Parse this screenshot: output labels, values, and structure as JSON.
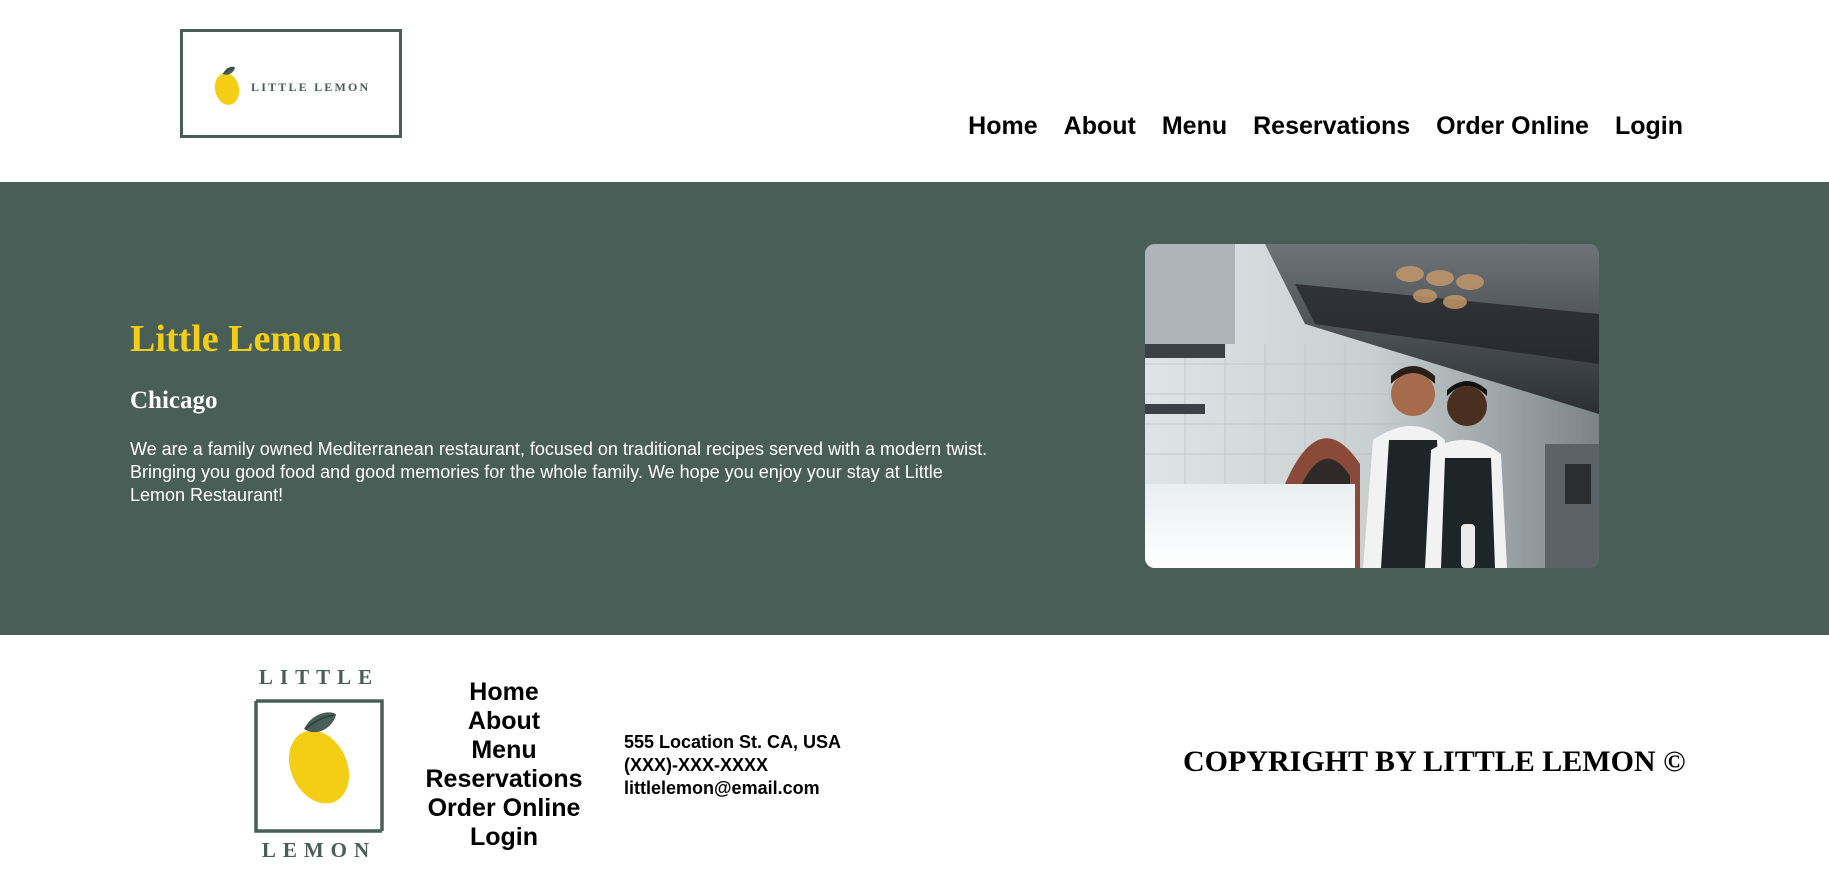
{
  "header": {
    "logo_text": "LITTLE LEMON",
    "nav": [
      "Home",
      "About",
      "Menu",
      "Reservations",
      "Order Online",
      "Login"
    ]
  },
  "hero": {
    "title": "Little Lemon",
    "subtitle": "Chicago",
    "description": "We are a family owned Mediterranean restaurant, focused on traditional recipes served with a modern twist. Bringing you good food and good memories for the whole family. We hope you enjoy your stay at Little Lemon Restaurant!",
    "image_icon": "chefs-in-kitchen-photo"
  },
  "footer": {
    "logo_top": "LITTLE",
    "logo_bottom": "LEMON",
    "nav": [
      "Home",
      "About",
      "Menu",
      "Reservations",
      "Order Online",
      "Login"
    ],
    "contact": {
      "address": "555 Location St. CA, USA",
      "phone": "(XXX)-XXX-XXXX",
      "email": "littlelemon@email.com"
    },
    "copyright": "COPYRIGHT BY LITTLE LEMON ©"
  },
  "colors": {
    "primary_green": "#495e57",
    "primary_yellow": "#f4ce14",
    "white": "#ffffff"
  }
}
